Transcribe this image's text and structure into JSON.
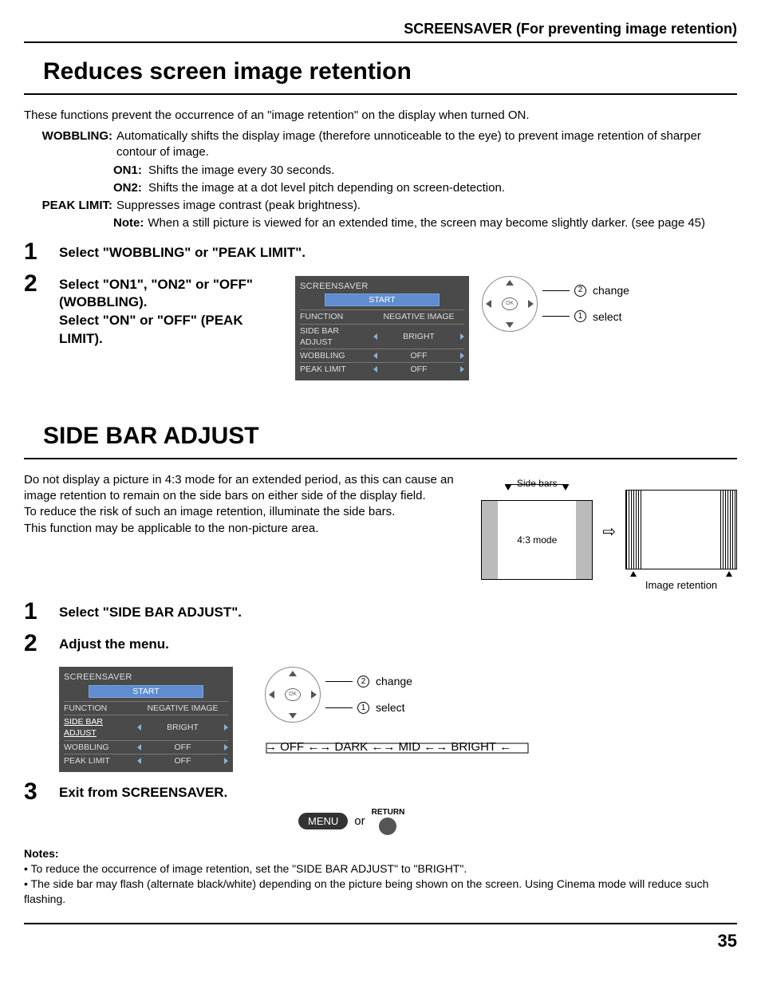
{
  "header": "SCREENSAVER (For preventing image retention)",
  "section1": {
    "title": "Reduces screen image retention",
    "intro": "These functions prevent the occurrence of an \"image retention\" on the display when turned ON.",
    "wobbling_label": "WOBBLING:",
    "wobbling_desc": "Automatically shifts the display image (therefore unnoticeable to the eye) to prevent image retention of sharper contour of image.",
    "on1_label": "ON1:",
    "on1_desc": "Shifts the image every 30 seconds.",
    "on2_label": "ON2:",
    "on2_desc": "Shifts the image at a dot level pitch depending on screen-detection.",
    "peak_label": "PEAK LIMIT:",
    "peak_desc": "Suppresses image contrast (peak brightness).",
    "note_label": "Note:",
    "note_desc": "When a still picture is viewed for an extended time, the screen may become slightly darker. (see page 45)",
    "step1": "Select \"WOBBLING\" or \"PEAK LIMIT\".",
    "step2a": "Select \"ON1\", \"ON2\" or \"OFF\" (WOBBLING).",
    "step2b": "Select \"ON\" or \"OFF\" (PEAK LIMIT)."
  },
  "osmenu": {
    "title": "SCREENSAVER",
    "start": "START",
    "rows": [
      {
        "label": "FUNCTION",
        "value": "NEGATIVE IMAGE"
      },
      {
        "label": "SIDE BAR ADJUST",
        "value": "BRIGHT"
      },
      {
        "label": "WOBBLING",
        "value": "OFF"
      },
      {
        "label": "PEAK LIMIT",
        "value": "OFF"
      }
    ]
  },
  "dpad": {
    "ok": "OK",
    "change_num": "2",
    "change": "change",
    "select_num": "1",
    "select": "select"
  },
  "section2": {
    "title": "SIDE BAR ADJUST",
    "p1": "Do not display a picture in 4:3 mode for an extended period, as this can cause an image retention to remain on the side bars on either side of the display field.",
    "p2": "To reduce the risk of such an image retention, illuminate the side bars.",
    "p3": "This function may be applicable to the non-picture area.",
    "diag_sidebars": "Side bars",
    "diag_43": "4:3 mode",
    "diag_ir": "Image retention",
    "step1": "Select \"SIDE BAR ADJUST\".",
    "step2": "Adjust the menu.",
    "flow": {
      "off": "OFF",
      "dark": "DARK",
      "mid": "MID",
      "bright": "BRIGHT"
    },
    "step3": "Exit from SCREENSAVER.",
    "menu": "MENU",
    "or": "or",
    "return": "RETURN",
    "highlight_row_index_menu2": 1
  },
  "osmenu2_highlight": 1,
  "notes": {
    "heading": "Notes:",
    "n1": "To reduce the occurrence of image retention, set the \"SIDE BAR ADJUST\" to \"BRIGHT\".",
    "n2": "The side bar may flash (alternate black/white) depending on the picture being shown on the screen. Using Cinema mode will reduce such flashing."
  },
  "page_number": "35"
}
